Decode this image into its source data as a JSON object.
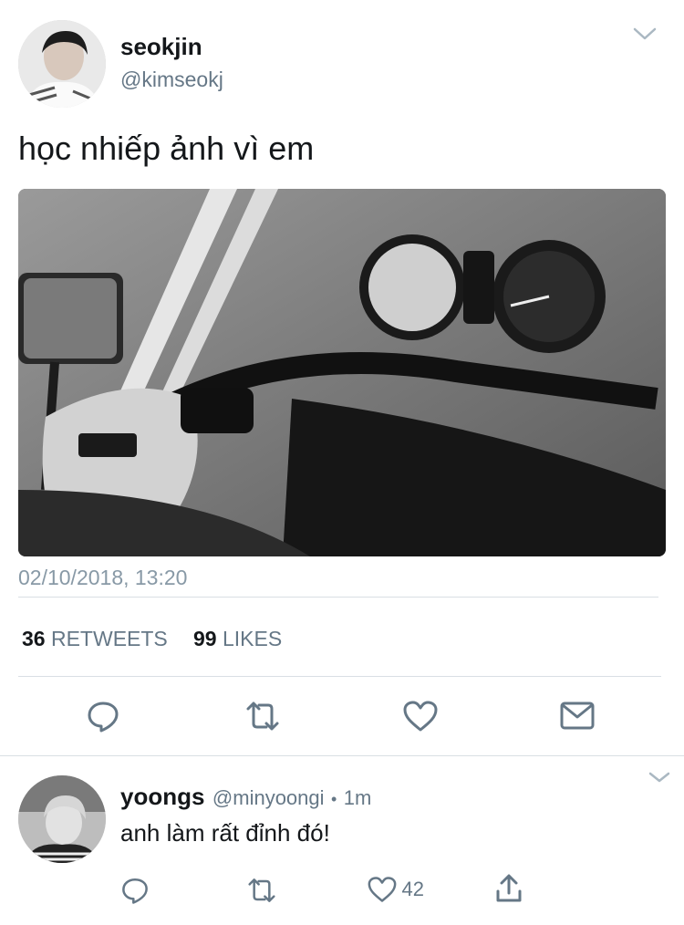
{
  "tweet": {
    "author_name": "seokjin",
    "author_handle": "@kimseokj",
    "text": "học nhiếp ảnh vì em",
    "timestamp": "02/10/2018, 13:20",
    "retweets_count": "36",
    "retweets_label": "RETWEETS",
    "likes_count": "99",
    "likes_label": "LIKES",
    "media_desc": "motorcycle-handlebar-photo",
    "icons": [
      "reply-icon",
      "retweet-icon",
      "like-icon",
      "message-icon"
    ]
  },
  "reply": {
    "author_name": "yoongs",
    "author_handle": "@minyoongi",
    "separator": "•",
    "time": "1m",
    "text": "anh làm rất đỉnh đó!",
    "like_count": "42",
    "icons": [
      "reply-icon",
      "retweet-icon",
      "like-icon",
      "share-icon"
    ]
  },
  "colors": {
    "text": "#14171a",
    "secondary": "#657786",
    "divider": "#d9dfe4"
  }
}
